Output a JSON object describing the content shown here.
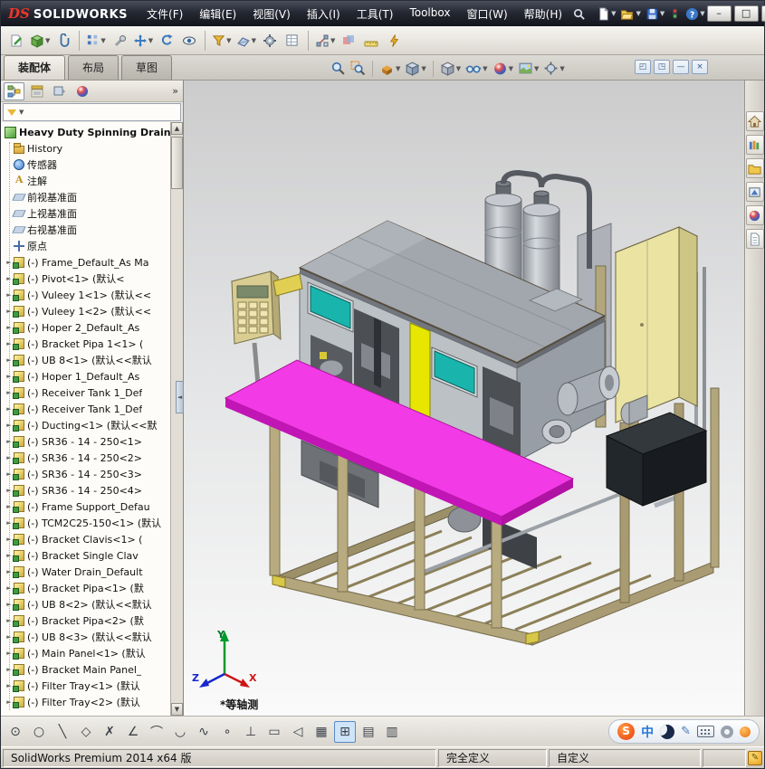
{
  "titlebar": {
    "logo_mark": "DS",
    "logo_text": "SOLIDWORKS",
    "menus": [
      {
        "label": "文件(F)"
      },
      {
        "label": "编辑(E)"
      },
      {
        "label": "视图(V)"
      },
      {
        "label": "插入(I)"
      },
      {
        "label": "工具(T)"
      },
      {
        "label": "Toolbox"
      },
      {
        "label": "窗口(W)"
      },
      {
        "label": "帮助(H)"
      }
    ],
    "window_buttons": [
      {
        "name": "minimize-button",
        "glyph": "–"
      },
      {
        "name": "maximize-button",
        "glyph": "□"
      },
      {
        "name": "close-button",
        "glyph": "×"
      }
    ]
  },
  "toolbar_icons": [
    "edit-component",
    "insert-component",
    "mate",
    "component-pattern",
    "smart-fasteners",
    "move-component",
    "rotate-component",
    "show-hide-components",
    "assembly-features",
    "reference-geometry",
    "motion-study",
    "bill-of-materials",
    "exploded-view",
    "interference-detection",
    "measure",
    "assembly-visualization"
  ],
  "command_tabs": [
    {
      "label": "装配体",
      "active": true
    },
    {
      "label": "布局"
    },
    {
      "label": "草图"
    }
  ],
  "headsup_icons": [
    "zoom-fit",
    "zoom-area",
    "section-view",
    "view-orientation",
    "display-style",
    "hide-show-items",
    "edit-appearance",
    "apply-scene",
    "view-settings"
  ],
  "child_window_buttons": [
    {
      "name": "window-cascade-icon",
      "glyph": "◰"
    },
    {
      "name": "window-restore-icon",
      "glyph": "◳"
    },
    {
      "name": "window-minimize-icon",
      "glyph": "—"
    },
    {
      "name": "window-close-icon",
      "glyph": "×"
    }
  ],
  "feature_panel": {
    "root_label": "Heavy Duty Spinning Drain",
    "items": [
      {
        "type": "history",
        "label": "History"
      },
      {
        "type": "sensors",
        "label": "传感器"
      },
      {
        "type": "annotations",
        "label": "注解"
      },
      {
        "type": "plane",
        "label": "前视基准面"
      },
      {
        "type": "plane",
        "label": "上视基准面"
      },
      {
        "type": "plane",
        "label": "右视基准面"
      },
      {
        "type": "origin",
        "label": "原点"
      },
      {
        "type": "part",
        "label": "(-) Frame_Default_As Ma"
      },
      {
        "type": "part",
        "label": "(-) Pivot<1> (默认<"
      },
      {
        "type": "part",
        "label": "(-) Vuleey 1<1> (默认<<"
      },
      {
        "type": "part",
        "label": "(-) Vuleey 1<2> (默认<<"
      },
      {
        "type": "part",
        "label": "(-) Hoper 2_Default_As"
      },
      {
        "type": "part",
        "label": "(-) Bracket Pipa 1<1> ("
      },
      {
        "type": "part",
        "label": "(-) UB 8<1> (默认<<默认"
      },
      {
        "type": "part",
        "label": "(-) Hoper 1_Default_As"
      },
      {
        "type": "part",
        "label": "(-) Receiver Tank 1_Def"
      },
      {
        "type": "part",
        "label": "(-) Receiver Tank 1_Def"
      },
      {
        "type": "part",
        "label": "(-) Ducting<1> (默认<<默"
      },
      {
        "type": "part",
        "label": "(-) SR36 - 14 - 250<1>"
      },
      {
        "type": "part",
        "label": "(-) SR36 - 14 - 250<2>"
      },
      {
        "type": "part",
        "label": "(-) SR36 - 14 - 250<3>"
      },
      {
        "type": "part",
        "label": "(-) SR36 - 14 - 250<4>"
      },
      {
        "type": "part",
        "label": "(-) Frame Support_Defau"
      },
      {
        "type": "part",
        "label": "(-) TCM2C25-150<1> (默认"
      },
      {
        "type": "part",
        "label": "(-) Bracket Clavis<1> ("
      },
      {
        "type": "part",
        "label": "(-) Bracket Single Clav"
      },
      {
        "type": "part",
        "label": "(-) Water Drain_Default"
      },
      {
        "type": "part",
        "label": "(-) Bracket Pipa<1> (默"
      },
      {
        "type": "part",
        "label": "(-) UB 8<2> (默认<<默认"
      },
      {
        "type": "part",
        "label": "(-) Bracket Pipa<2> (默"
      },
      {
        "type": "part",
        "label": "(-) UB 8<3> (默认<<默认"
      },
      {
        "type": "part",
        "label": "(-) Main Panel<1> (默认"
      },
      {
        "type": "part",
        "label": "(-) Bracket Main Panel_"
      },
      {
        "type": "part",
        "label": "(-) Filter Tray<1> (默认"
      },
      {
        "type": "part",
        "label": "(-) Filter Tray<2> (默认"
      }
    ]
  },
  "taskpane_icons": [
    "resources-home",
    "design-library",
    "file-explorer",
    "view-palette",
    "appearances",
    "custom-properties"
  ],
  "viewport": {
    "view_orientation_label": "*等轴测"
  },
  "bottom_toolbar": {
    "icons": [
      {
        "name": "smart-dimension-icon",
        "glyph": "⊙"
      },
      {
        "name": "circle-icon",
        "glyph": "○"
      },
      {
        "name": "line-icon",
        "glyph": "╲"
      },
      {
        "name": "polygon-icon",
        "glyph": "◇"
      },
      {
        "name": "trim-entities-icon",
        "glyph": "✗"
      },
      {
        "name": "sketch-fillet-icon",
        "glyph": "∠"
      },
      {
        "name": "arc-icon",
        "glyph": "⌒"
      },
      {
        "name": "tangent-arc-icon",
        "glyph": "◡"
      },
      {
        "name": "spline-icon",
        "glyph": "∿"
      },
      {
        "name": "point-icon",
        "glyph": "∘"
      },
      {
        "name": "perpendicular-icon",
        "glyph": "⊥"
      },
      {
        "name": "rectangle-icon",
        "glyph": "▭"
      },
      {
        "name": "mirror-entities-icon",
        "glyph": "◁"
      },
      {
        "name": "linear-sketch-pattern-icon",
        "glyph": "▦"
      },
      {
        "name": "grid-snap-icon",
        "glyph": "⊞",
        "pressed": true
      },
      {
        "name": "table-icon",
        "glyph": "▤"
      },
      {
        "name": "hatch-icon",
        "glyph": "▥"
      }
    ]
  },
  "ime_bar": {
    "logo_letter": "S",
    "mode_label": "中"
  },
  "statusbar": {
    "product": "SolidWorks Premium 2014 x64 版",
    "definition_status": "完全定义",
    "customize_label": "自定义"
  }
}
